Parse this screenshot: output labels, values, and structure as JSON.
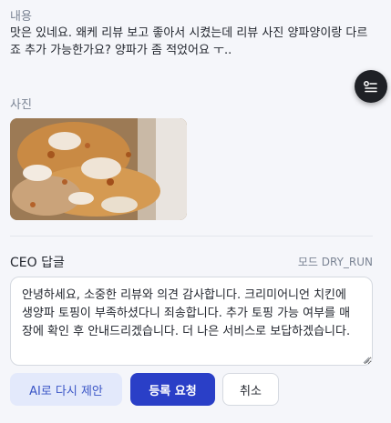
{
  "review": {
    "content_label": "내용",
    "text": "맛은 있네요. 왜케 리뷰 보고 좋아서 시켰는데 리뷰 사진 양파양이랑 다르죠 추가 가능한가요? 양파가 좀 적었어요 ㅜ..",
    "photo_label": "사진"
  },
  "reply": {
    "label": "CEO 답글",
    "mode": "모드 DRY_RUN",
    "text": "안녕하세요, 소중한 리뷰와 의견 감사합니다. 크리미어니언 치킨에 생양파 토핑이 부족하셨다니 죄송합니다. 추가 토핑 가능 여부를 매장에 확인 후 안내드리겠습니다. 더 나은 서비스로 보답하겠습니다."
  },
  "actions": {
    "ai_retry": "AI로 다시 제안",
    "submit": "등록 요청",
    "cancel": "취소"
  },
  "floating_button_icon": "list-toggle-icon",
  "colors": {
    "primary": "#2a3fc7",
    "secondary_bg": "#e3e9fb",
    "page_bg": "#f5f6fa"
  }
}
